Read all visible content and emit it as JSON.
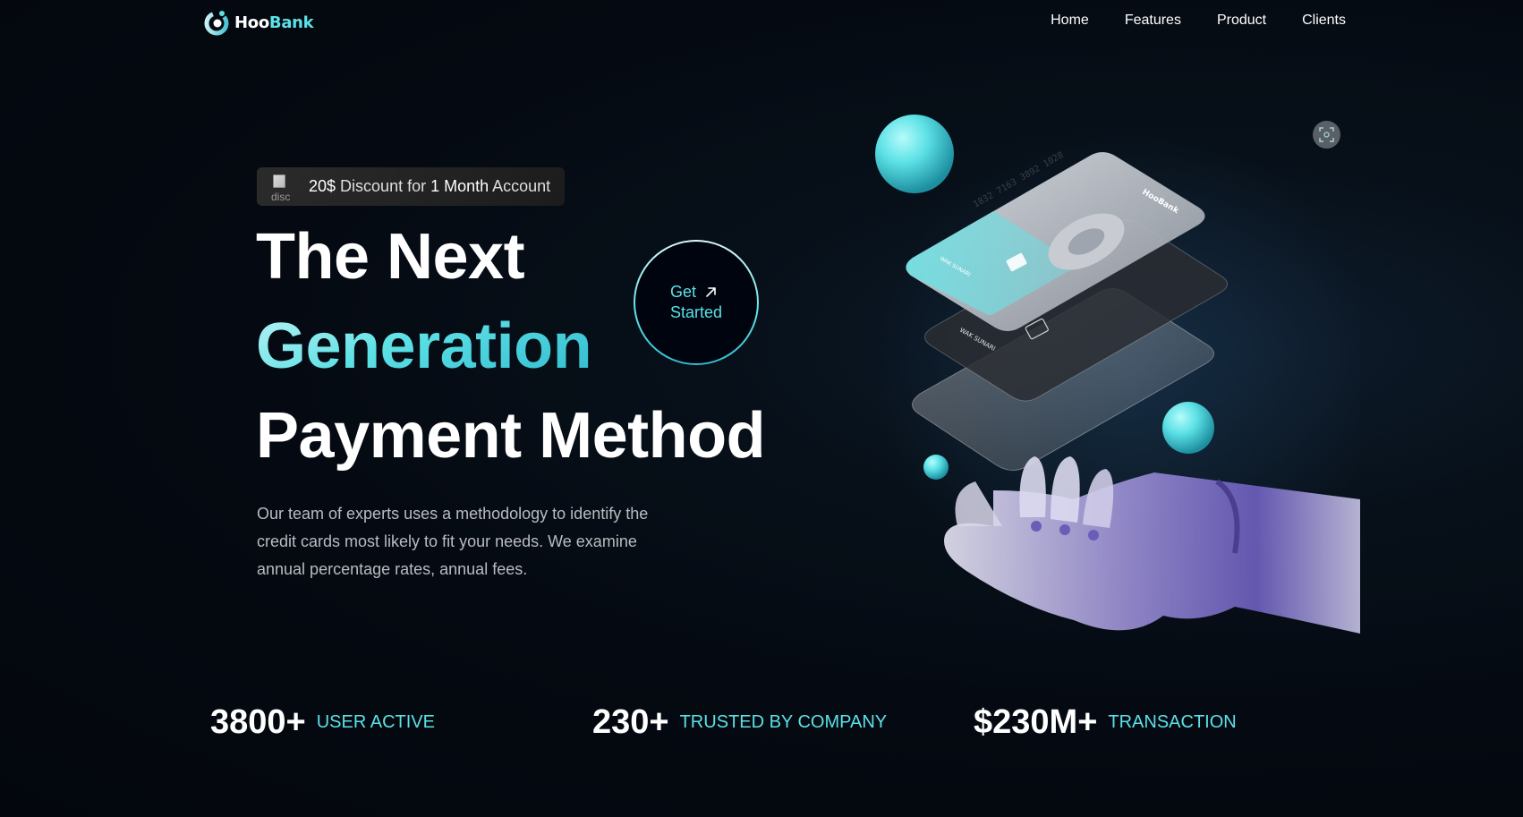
{
  "brand": {
    "name_part1": "Hoo",
    "name_part2": "Bank",
    "logo_icon": "hoobank-logo-icon",
    "accent_color": "#5ce1e6"
  },
  "nav": {
    "items": [
      {
        "label": "Home"
      },
      {
        "label": "Features"
      },
      {
        "label": "Product"
      },
      {
        "label": "Clients"
      }
    ]
  },
  "hero": {
    "discount": {
      "image_alt": "disc",
      "amount": "20$",
      "text_mid": " Discount for ",
      "months": "1",
      "month_word": " Month",
      "text_end": " Account"
    },
    "headline_line1": "The Next",
    "headline_line2": "Generation",
    "headline_line3": "Payment Method",
    "cta_line1": "Get",
    "cta_line2": "Started",
    "cta_icon": "arrow-up-right-icon",
    "description": "Our team of experts uses a methodology to identify the credit cards most likely to fit your needs. We examine annual percentage rates, annual fees.",
    "illustration": "robot-hand-holding-credit-cards",
    "card_number": "1832 7163 3892 1028",
    "card_holder": "WAK SUNARI",
    "card_brand": "HooBank",
    "scan_icon": "screen-capture-icon"
  },
  "stats": [
    {
      "value": "3800+",
      "label": "User Active"
    },
    {
      "value": "230+",
      "label": "Trusted by Company"
    },
    {
      "value": "$230M+",
      "label": "Transaction"
    }
  ]
}
